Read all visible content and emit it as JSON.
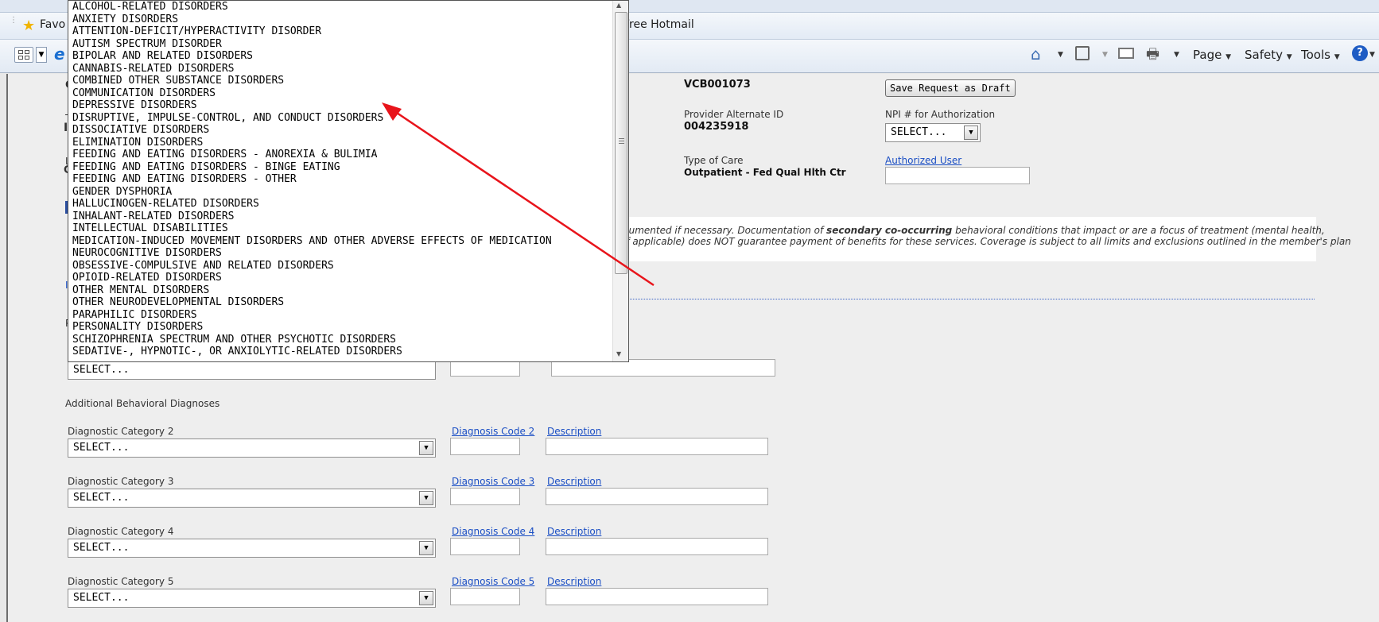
{
  "browser": {
    "favorites_label": "Favo",
    "hotmail_label": "Free Hotmail",
    "commands": {
      "page": "Page",
      "safety": "Safety",
      "tools": "Tools"
    }
  },
  "header": {
    "vendor_id": "VCB001073",
    "provider_alt_id_label": "Provider Alternate ID",
    "provider_alt_id": "004235918",
    "type_of_care_label": "Type of Care",
    "type_of_care": "Outpatient - Fed Qual Hlth Ctr",
    "save_draft_label": "Save Request as Draft",
    "npi_label": "NPI # for Authorization",
    "npi_value": "SELECT...",
    "authorized_user_label": "Authorized User"
  },
  "notice": {
    "line1_pre": "cumented if necessary. Documentation of ",
    "line1_bold": "secondary co-occurring",
    "line1_post": " behavioral conditions that impact or are a focus of treatment (mental health,",
    "line2": "if applicable) does NOT guarantee payment of benefits for these services. Coverage is subject to all limits and exclusions outlined in the member's plan"
  },
  "primary_select_value": "SELECT...",
  "additional_heading": "Additional Behavioral Diagnoses",
  "diagnoses": [
    {
      "category_label": "Diagnostic Category 2",
      "code_label": "Diagnosis Code 2",
      "desc_label": "Description",
      "value": "SELECT..."
    },
    {
      "category_label": "Diagnostic Category 3",
      "code_label": "Diagnosis Code 3",
      "desc_label": "Description",
      "value": "SELECT..."
    },
    {
      "category_label": "Diagnostic Category 4",
      "code_label": "Diagnosis Code 4",
      "desc_label": "Description",
      "value": "SELECT..."
    },
    {
      "category_label": "Diagnostic Category 5",
      "code_label": "Diagnosis Code 5",
      "desc_label": "Description",
      "value": "SELECT..."
    }
  ],
  "dropdown_options": [
    "ALCOHOL-RELATED DISORDERS",
    "ANXIETY DISORDERS",
    "ATTENTION-DEFICIT/HYPERACTIVITY DISORDER",
    "AUTISM SPECTRUM DISORDER",
    "BIPOLAR AND RELATED DISORDERS",
    "CANNABIS-RELATED DISORDERS",
    "COMBINED OTHER SUBSTANCE DISORDERS",
    "COMMUNICATION DISORDERS",
    "DEPRESSIVE DISORDERS",
    "DISRUPTIVE, IMPULSE-CONTROL, AND CONDUCT DISORDERS",
    "DISSOCIATIVE DISORDERS",
    "ELIMINATION DISORDERS",
    "FEEDING AND EATING DISORDERS - ANOREXIA & BULIMIA",
    "FEEDING AND EATING DISORDERS - BINGE EATING",
    "FEEDING AND EATING DISORDERS - OTHER",
    "GENDER DYSPHORIA",
    "HALLUCINOGEN-RELATED DISORDERS",
    "INHALANT-RELATED DISORDERS",
    "INTELLECTUAL DISABILITIES",
    "MEDICATION-INDUCED MOVEMENT DISORDERS AND OTHER ADVERSE EFFECTS OF MEDICATION",
    "NEUROCOGNITIVE DISORDERS",
    "OBSESSIVE-COMPULSIVE AND RELATED DISORDERS",
    "OPIOID-RELATED DISORDERS",
    "OTHER MENTAL DISORDERS",
    "OTHER NEURODEVELOPMENTAL DISORDERS",
    "PARAPHILIC DISORDERS",
    "PERSONALITY DISORDERS",
    "SCHIZOPHRENIA SPECTRUM AND OTHER PSYCHOTIC DISORDERS",
    "SEDATIVE-, HYPNOTIC-, OR ANXIOLYTIC-RELATED DISORDERS"
  ],
  "annotation_color": "#e8141b"
}
